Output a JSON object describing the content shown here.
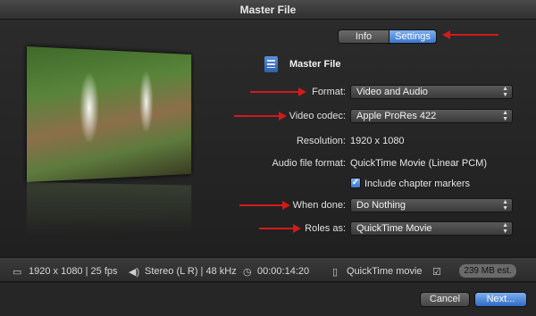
{
  "window": {
    "title": "Master File"
  },
  "tabs": {
    "info": "Info",
    "settings": "Settings"
  },
  "header": {
    "title": "Master File",
    "icon": "document-icon"
  },
  "fields": {
    "format": {
      "label": "Format:",
      "value": "Video and Audio"
    },
    "video_codec": {
      "label": "Video codec:",
      "value": "Apple ProRes 422"
    },
    "resolution": {
      "label": "Resolution:",
      "value": "1920 x 1080"
    },
    "audio_format": {
      "label": "Audio file format:",
      "value": "QuickTime Movie (Linear PCM)"
    },
    "chapter_markers": {
      "label": "Include chapter markers",
      "checked": true
    },
    "when_done": {
      "label": "When done:",
      "value": "Do Nothing"
    },
    "roles_as": {
      "label": "Roles as:",
      "value": "QuickTime Movie"
    }
  },
  "status": {
    "video": "1920 x 1080 | 25 fps",
    "audio": "Stereo (L R) | 48 kHz",
    "duration": "00:00:14:20",
    "container": "QuickTime movie",
    "size_estimate": "239 MB est."
  },
  "buttons": {
    "cancel": "Cancel",
    "next": "Next..."
  },
  "colors": {
    "accent": "#3a77cf",
    "annotation": "#d11a1a"
  }
}
